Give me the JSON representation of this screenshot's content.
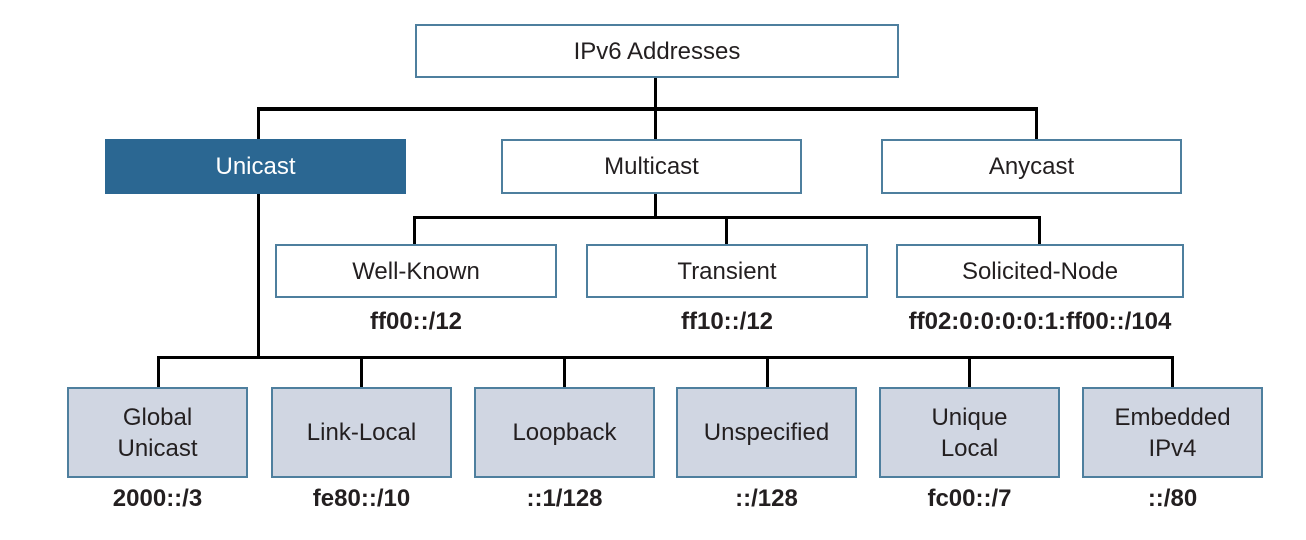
{
  "root": {
    "label": "IPv6 Addresses"
  },
  "level1": [
    {
      "id": "unicast",
      "label": "Unicast",
      "highlighted": true
    },
    {
      "id": "multicast",
      "label": "Multicast",
      "highlighted": false
    },
    {
      "id": "anycast",
      "label": "Anycast",
      "highlighted": false
    }
  ],
  "multicast_children": [
    {
      "label": "Well-Known",
      "prefix": "ff00::/12"
    },
    {
      "label": "Transient",
      "prefix": "ff10::/12"
    },
    {
      "label": "Solicited-Node",
      "prefix": "ff02:0:0:0:0:1:ff00::/104"
    }
  ],
  "unicast_children": [
    {
      "label": "Global\nUnicast",
      "prefix": "2000::/3"
    },
    {
      "label": "Link-Local",
      "prefix": "fe80::/10"
    },
    {
      "label": "Loopback",
      "prefix": "::1/128"
    },
    {
      "label": "Unspecified",
      "prefix": "::/128"
    },
    {
      "label": "Unique\nLocal",
      "prefix": "fc00::/7"
    },
    {
      "label": "Embedded\nIPv4",
      "prefix": "::/80"
    }
  ],
  "colors": {
    "highlight": "#2b6792",
    "leaf_fill": "#d0d6e2",
    "border": "#4e7f9e",
    "connector": "#000000"
  }
}
